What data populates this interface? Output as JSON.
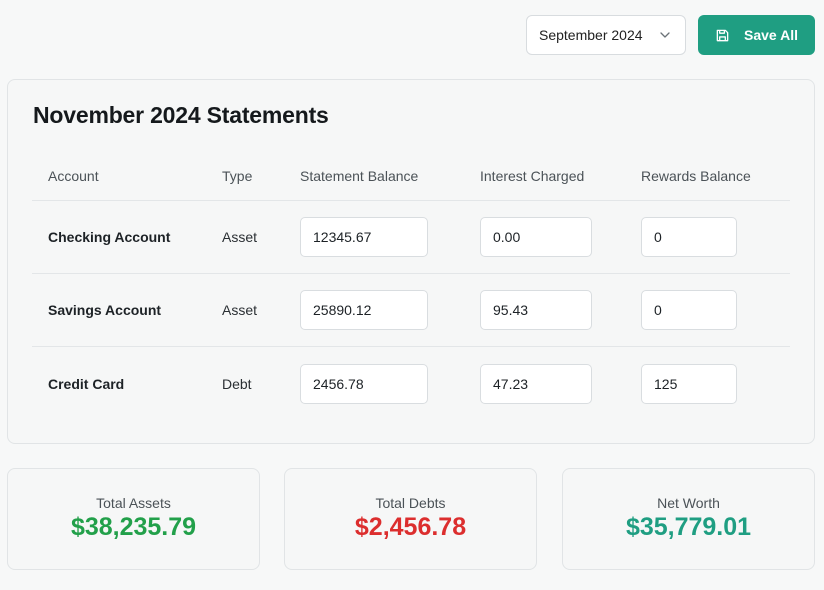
{
  "toolbar": {
    "month_value": "September 2024",
    "save_label": "Save All"
  },
  "statements": {
    "title": "November 2024 Statements",
    "columns": [
      "Account",
      "Type",
      "Statement Balance",
      "Interest Charged",
      "Rewards Balance"
    ],
    "rows": [
      {
        "account": "Checking Account",
        "type": "Asset",
        "balance": "12345.67",
        "interest": "0.00",
        "rewards": "0"
      },
      {
        "account": "Savings Account",
        "type": "Asset",
        "balance": "25890.12",
        "interest": "95.43",
        "rewards": "0"
      },
      {
        "account": "Credit Card",
        "type": "Debt",
        "balance": "2456.78",
        "interest": "47.23",
        "rewards": "125"
      }
    ]
  },
  "summary": {
    "assets": {
      "label": "Total Assets",
      "value": "$38,235.79",
      "color": "#22a04a"
    },
    "debts": {
      "label": "Total Debts",
      "value": "$2,456.78",
      "color": "#dc2e2e"
    },
    "net": {
      "label": "Net Worth",
      "value": "$35,779.01",
      "color": "#1f9e82"
    }
  },
  "colors": {
    "accent": "#1f9e82"
  },
  "icons": {
    "save": "save-icon",
    "dropdown": "chevron-down-icon"
  }
}
